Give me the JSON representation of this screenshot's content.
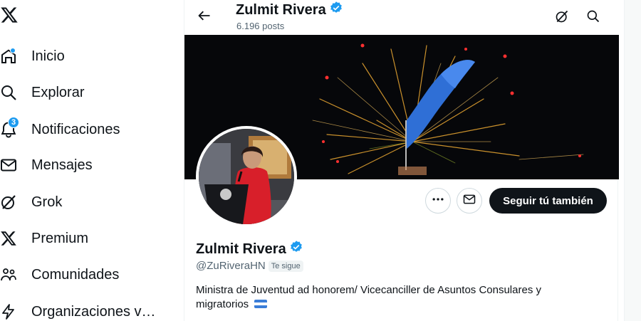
{
  "nav": {
    "items": [
      {
        "label": "Inicio",
        "icon": "home-icon"
      },
      {
        "label": "Explorar",
        "icon": "search-icon"
      },
      {
        "label": "Notificaciones",
        "icon": "bell-icon",
        "badge": "3"
      },
      {
        "label": "Mensajes",
        "icon": "envelope-icon"
      },
      {
        "label": "Grok",
        "icon": "grok-icon"
      },
      {
        "label": "Premium",
        "icon": "x-logo-icon"
      },
      {
        "label": "Comunidades",
        "icon": "people-icon"
      },
      {
        "label": "Organizaciones v…",
        "icon": "lightning-icon"
      }
    ]
  },
  "header": {
    "name": "Zulmit Rivera",
    "posts": "6.196 posts"
  },
  "profile": {
    "name": "Zulmit Rivera",
    "handle": "@ZuRiveraHN",
    "follows_you": "Te sigue",
    "bio": "Ministra de Juventud ad honorem/ Vicecanciller de Asuntos Consulares y migratorios",
    "follow_label": "Seguir tú también"
  },
  "colors": {
    "accent": "#1d9bf0",
    "text": "#0f1419",
    "secondary": "#536471",
    "follow_bg": "#0f1419"
  }
}
